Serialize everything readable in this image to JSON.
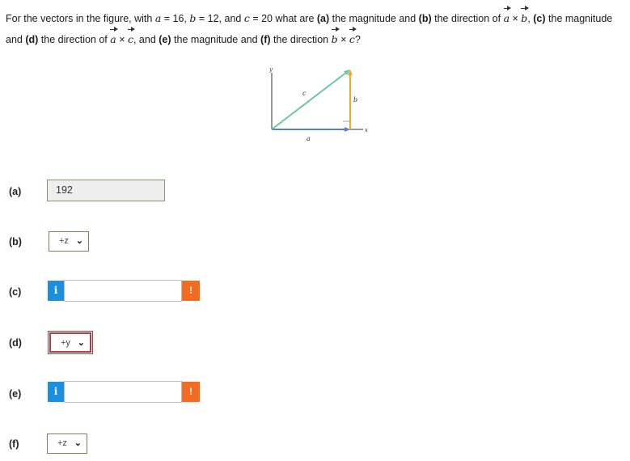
{
  "question": {
    "p1": "For the vectors in the figure, with ",
    "a_var": "a",
    "a_eq": " = 16, ",
    "b_var": "b",
    "b_eq": " = 12, and ",
    "c_var": "c",
    "c_eq": " = 20 what are ",
    "part_a": "(a)",
    "t2": " the magnitude and ",
    "part_b": "(b)",
    "t3": " the direction of ",
    "vec_a": "a",
    "cross": " × ",
    "vec_b": "b",
    "comma": ", ",
    "part_c": "(c)",
    "t4": " the magnitude and ",
    "part_d": "(d)",
    "t5": " the direction of ",
    "vec_a2": "a",
    "cross2": " × ",
    "vec_c": "c",
    "t6": ", and ",
    "part_e": "(e)",
    "t7": " the magnitude and ",
    "part_f": "(f)",
    "t8": " the direction ",
    "vec_b2": "b",
    "cross3": " × ",
    "vec_c2": "c",
    "end": "?"
  },
  "figure": {
    "label_y": "y",
    "label_x": "x",
    "label_a": "a",
    "label_b": "b",
    "label_c": "c",
    "color_a": "#5b7fc1",
    "color_b": "#f5a623",
    "color_c": "#6cc5a3"
  },
  "rows": [
    {
      "label": "(a)",
      "value": "192"
    },
    {
      "label": "(b)",
      "selected": "+z"
    },
    {
      "label": "(c)",
      "info": "i",
      "warn": "!"
    },
    {
      "label": "(d)",
      "selected": "+y"
    },
    {
      "label": "(e)",
      "info": "i",
      "warn": "!"
    },
    {
      "label": "(f)",
      "selected": "+z"
    }
  ],
  "colors": {
    "info": "#1b8fe0",
    "warn": "#f36b21",
    "error_border": "#b04040"
  }
}
